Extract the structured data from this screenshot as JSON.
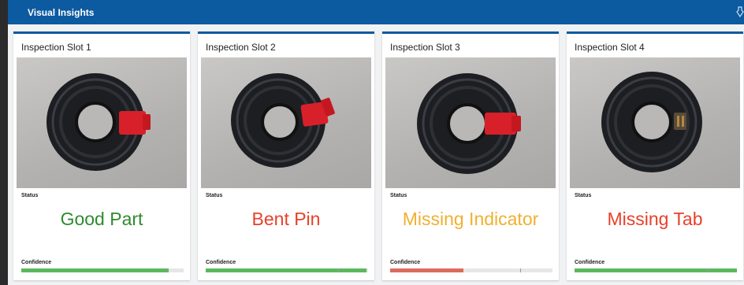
{
  "header": {
    "title": "Visual Insights",
    "icon": "tool-icon"
  },
  "colors": {
    "header_bg": "#0c5aa0",
    "good": "#2e8b2e",
    "bad": "#e8402a",
    "warn": "#f0b030",
    "bar_green": "#5cb85c",
    "bar_red": "#dc6b5c"
  },
  "slots": [
    {
      "title": "Inspection Slot 1",
      "status_label": "Status",
      "status": "Good Part",
      "status_color": "#2e8b2e",
      "confidence_label": "Confidence",
      "confidence": 0.91,
      "bar_color": "#5cb85c"
    },
    {
      "title": "Inspection Slot 2",
      "status_label": "Status",
      "status": "Bent Pin",
      "status_color": "#e8402a",
      "confidence_label": "Confidence",
      "confidence": 0.99,
      "bar_color": "#5cb85c"
    },
    {
      "title": "Inspection Slot 3",
      "status_label": "Status",
      "status": "Missing Indicator",
      "status_color": "#f0b030",
      "confidence_label": "Confidence",
      "confidence": 0.45,
      "bar_color": "#dc6b5c"
    },
    {
      "title": "Inspection Slot 4",
      "status_label": "Status",
      "status": "Missing Tab",
      "status_color": "#e8402a",
      "confidence_label": "Confidence",
      "confidence": 1.0,
      "bar_color": "#5cb85c"
    }
  ]
}
